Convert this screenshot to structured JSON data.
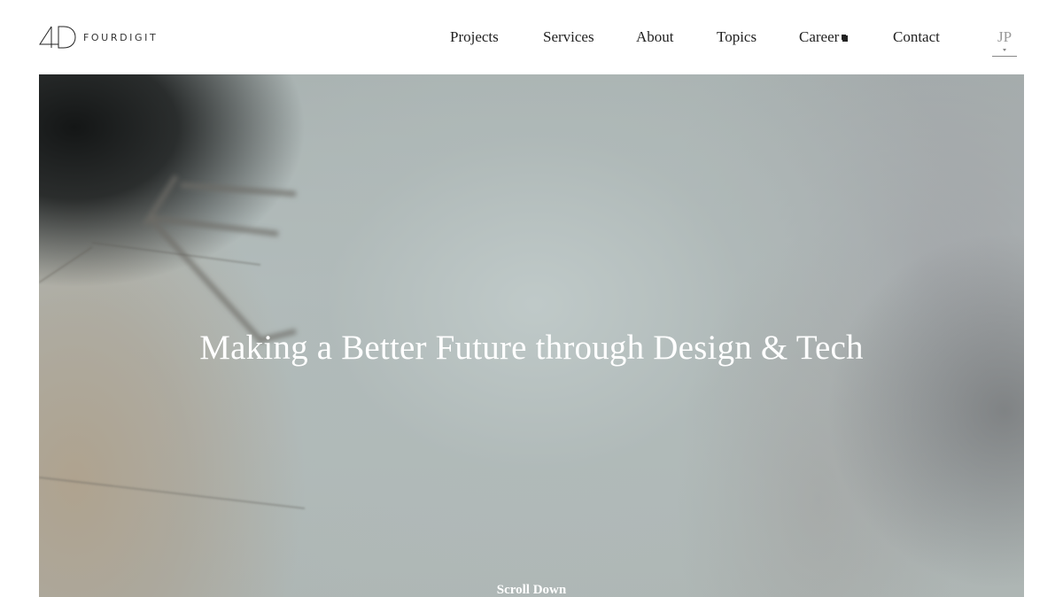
{
  "logo": {
    "text": "FOURDIGIT"
  },
  "nav": {
    "items": [
      {
        "label": "Projects"
      },
      {
        "label": "Services"
      },
      {
        "label": "About"
      },
      {
        "label": "Topics"
      },
      {
        "label": "Career",
        "external_icon": "external-link-icon"
      },
      {
        "label": "Contact"
      }
    ]
  },
  "language": {
    "label": "JP"
  },
  "hero": {
    "headline": "Making a Better Future through Design & Tech",
    "scroll_label": "Scroll Down"
  },
  "colors": {
    "text": "#222222",
    "lang_text": "#999999",
    "hero_text": "#ffffff"
  }
}
